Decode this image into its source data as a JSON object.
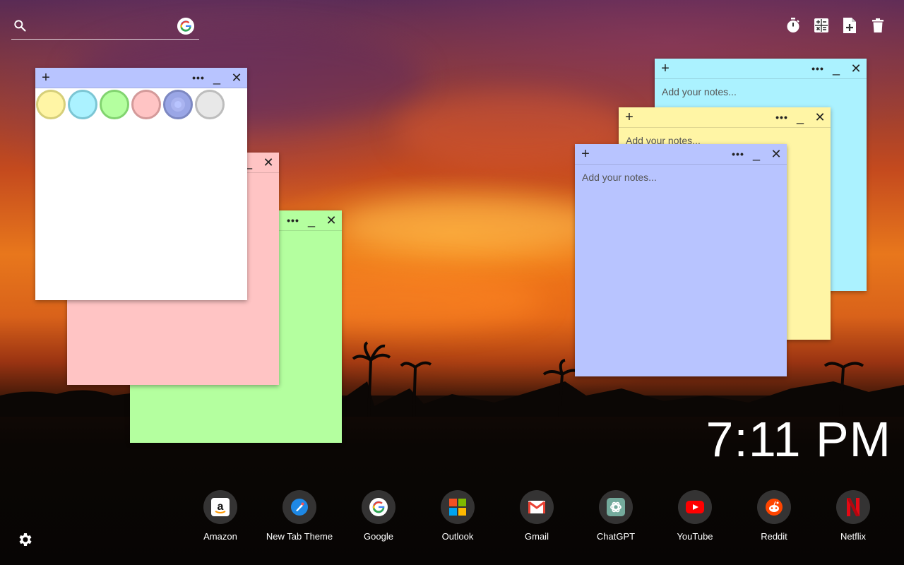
{
  "search": {
    "placeholder": ""
  },
  "tools": [
    {
      "name": "timer-icon"
    },
    {
      "name": "calculator-icon"
    },
    {
      "name": "add-note-icon"
    },
    {
      "name": "trash-icon"
    }
  ],
  "note_controls": {
    "plus": "+",
    "more": "•••",
    "min": "_",
    "close": "✕"
  },
  "notes": {
    "placeholder": "Add your notes...",
    "colors": {
      "white": "#ffffff",
      "pink": "#ffc4c4",
      "green": "#b4ff9f",
      "blue": "#abf2ff",
      "yellow": "#fff5a5",
      "purple": "#b8c4ff"
    }
  },
  "palette": {
    "colors": [
      "#fff5a5",
      "#abf2ff",
      "#b4ff9f",
      "#ffc4c4",
      "#b8c4ff",
      "#e8e8e8"
    ]
  },
  "clock": {
    "time": "7:11 PM"
  },
  "shortcuts": [
    {
      "label": "Amazon"
    },
    {
      "label": "New Tab Theme"
    },
    {
      "label": "Google"
    },
    {
      "label": "Outlook"
    },
    {
      "label": "Gmail"
    },
    {
      "label": "ChatGPT"
    },
    {
      "label": "YouTube"
    },
    {
      "label": "Reddit"
    },
    {
      "label": "Netflix"
    }
  ]
}
